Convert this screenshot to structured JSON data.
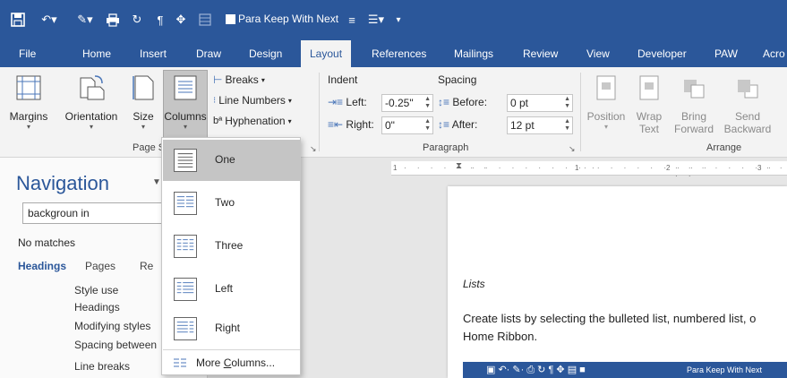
{
  "qat": {
    "keep_with_next_label": "Para Keep With Next"
  },
  "tabs": [
    "File",
    "Home",
    "Insert",
    "Draw",
    "Design",
    "Layout",
    "References",
    "Mailings",
    "Review",
    "View",
    "Developer",
    "PAW",
    "Acro"
  ],
  "active_tab": "Layout",
  "ribbon": {
    "page_setup": {
      "margins": "Margins",
      "orientation": "Orientation",
      "size": "Size",
      "columns": "Columns",
      "breaks": "Breaks",
      "line_numbers": "Line Numbers",
      "hyphenation": "Hyphenation",
      "group_label": "Page S"
    },
    "paragraph": {
      "indent_label": "Indent",
      "spacing_label": "Spacing",
      "left_label": "Left:",
      "left_value": "-0.25\"",
      "right_label": "Right:",
      "right_value": "0\"",
      "before_label": "Before:",
      "before_value": "0 pt",
      "after_label": "After:",
      "after_value": "12 pt",
      "group_label": "Paragraph"
    },
    "arrange": {
      "position": "Position",
      "wrap_1": "Wrap",
      "wrap_2": "Text",
      "bring_1": "Bring",
      "bring_2": "Forward",
      "send_1": "Send",
      "send_2": "Backward",
      "group_label": "Arrange"
    }
  },
  "columns_menu": {
    "items": [
      "One",
      "Two",
      "Three",
      "Left",
      "Right"
    ],
    "selected": "One",
    "more_prefix": "More ",
    "more_underlined": "C",
    "more_suffix": "olumns..."
  },
  "navigation": {
    "title": "Navigation",
    "search_value": "backgroun in",
    "no_matches": "No matches",
    "tabs": [
      "Headings",
      "Pages",
      "Re"
    ],
    "items": [
      "Style use",
      "Headings",
      "Modifying styles",
      "Spacing between",
      "Line breaks"
    ]
  },
  "ruler": {
    "ticks": [
      "1",
      "1",
      "2",
      "3"
    ]
  },
  "document": {
    "heading": "Lists",
    "para_line1": "Create lists by selecting the bulleted list, numbered list, o",
    "para_line2": "Home Ribbon.",
    "mini_qat_label": "Para Keep With Next"
  }
}
